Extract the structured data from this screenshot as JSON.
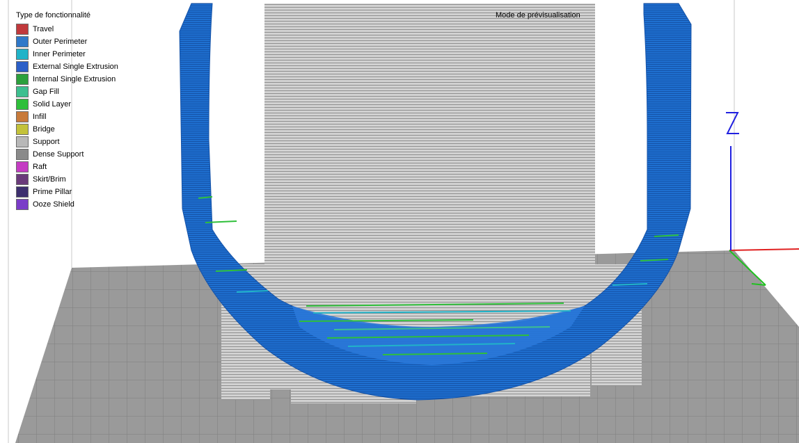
{
  "legend": {
    "title": "Type de fonctionnalité",
    "items": [
      {
        "label": "Travel",
        "color": "#c1393c"
      },
      {
        "label": "Outer Perimeter",
        "color": "#2f78c9"
      },
      {
        "label": "Inner Perimeter",
        "color": "#21b3c8"
      },
      {
        "label": "External Single Extrusion",
        "color": "#2b5fc8"
      },
      {
        "label": "Internal Single Extrusion",
        "color": "#2ca03c"
      },
      {
        "label": "Gap Fill",
        "color": "#3dbf8f"
      },
      {
        "label": "Solid Layer",
        "color": "#2fbf3a"
      },
      {
        "label": "Infill",
        "color": "#c87a3a"
      },
      {
        "label": "Bridge",
        "color": "#c3c23a"
      },
      {
        "label": "Support",
        "color": "#b8b8b8"
      },
      {
        "label": "Dense Support",
        "color": "#8a8a8a"
      },
      {
        "label": "Raft",
        "color": "#c43cc3"
      },
      {
        "label": "Skirt/Brim",
        "color": "#6a3a7a"
      },
      {
        "label": "Prime Pillar",
        "color": "#3d2f6e"
      },
      {
        "label": "Ooze Shield",
        "color": "#7a3cc8"
      }
    ]
  },
  "preview_mode_label": "Mode de prévisualisation",
  "colors": {
    "model_blue": "#1e6fd0",
    "support_gray": "#c4c4c4",
    "bed_gray": "#9a9a9a",
    "axis_x": "#e02020",
    "axis_y": "#20c020",
    "axis_z": "#2020e0"
  }
}
